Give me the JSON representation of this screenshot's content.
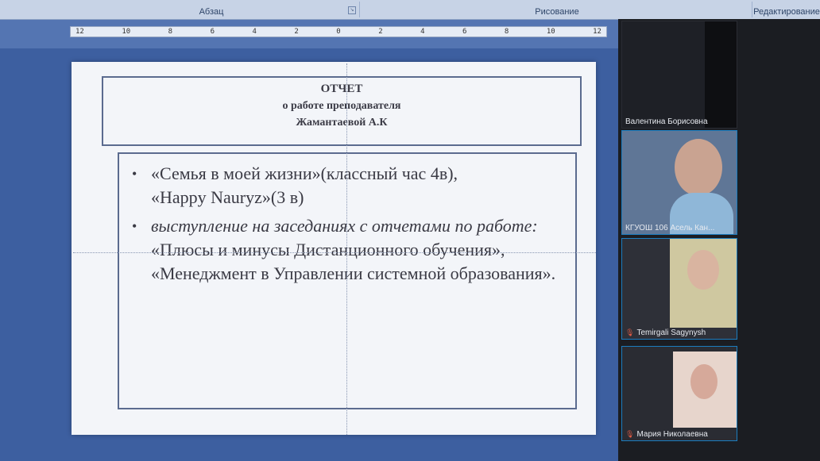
{
  "ribbon": {
    "groups": [
      "Абзац",
      "Рисование",
      "Редактирование"
    ]
  },
  "ruler": {
    "marks": [
      "12",
      "10",
      "8",
      "6",
      "4",
      "2",
      "0",
      "2",
      "4",
      "6",
      "8",
      "10",
      "12"
    ]
  },
  "slide": {
    "title_line1": "ОТЧЕТ",
    "title_line2": "о работе преподавателя",
    "title_line3": "Жамантаевой А.К",
    "bullets": [
      {
        "lines": [
          "«Семья в моей жизни»(классный час 4в),",
          "«Happy Nauryz»(3 в)"
        ]
      },
      {
        "italic": "выступление на заседаниях  с отчетами по работе:",
        "text": " «Плюсы и минусы Дистанционного обучения», «Менеджмент в Управлении системной образования»."
      }
    ]
  },
  "participants": [
    {
      "name": "Валентина Борисовна",
      "muted": false
    },
    {
      "name": "КГУОШ 106 Асель Кан...",
      "muted": false
    },
    {
      "name": "Temirgali Sagynysh",
      "muted": true
    },
    {
      "name": "Мария Николаевна",
      "muted": true
    }
  ]
}
